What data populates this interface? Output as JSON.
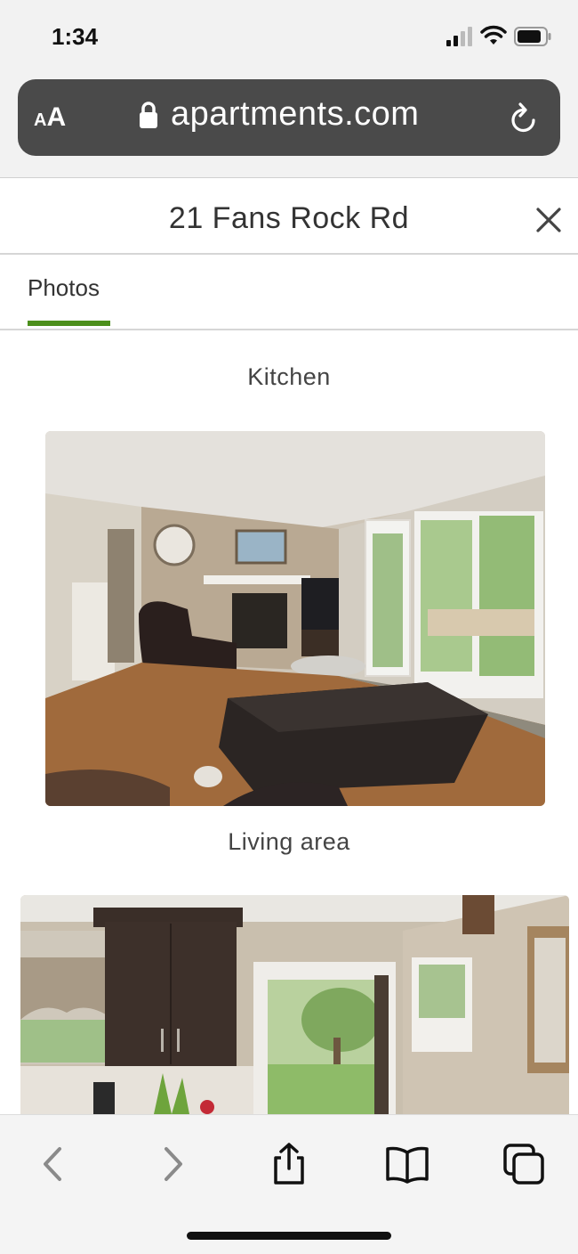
{
  "status_bar": {
    "time": "1:34"
  },
  "browser": {
    "aa_small": "A",
    "aa_big": "A",
    "url": "apartments.com"
  },
  "modal": {
    "title": "21 Fans Rock Rd",
    "tabs": [
      {
        "label": "Photos",
        "active": true
      }
    ],
    "accent_color": "#4c8f1c"
  },
  "gallery": {
    "captions": [
      "Kitchen",
      "Living area"
    ]
  }
}
